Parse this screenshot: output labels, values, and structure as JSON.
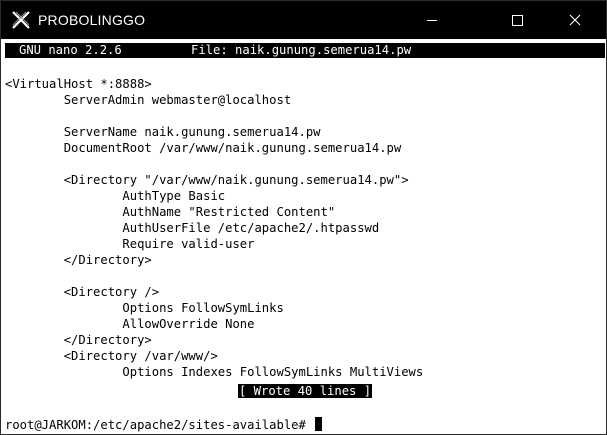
{
  "window": {
    "title": "PROBOLINGGO",
    "icon": "xterm-x-icon"
  },
  "nano": {
    "version": "GNU nano 2.2.6",
    "file_label": "File: naik.gunung.semerua14.pw",
    "lines": [
      "<VirtualHost *:8888>",
      "        ServerAdmin webmaster@localhost",
      "",
      "        ServerName naik.gunung.semerua14.pw",
      "        DocumentRoot /var/www/naik.gunung.semerua14.pw",
      "",
      "        <Directory \"/var/www/naik.gunung.semerua14.pw\">",
      "                AuthType Basic",
      "                AuthName \"Restricted Content\"",
      "                AuthUserFile /etc/apache2/.htpasswd",
      "                Require valid-user",
      "        </Directory>",
      "",
      "        <Directory />",
      "                Options FollowSymLinks",
      "                AllowOverride None",
      "        </Directory>",
      "        <Directory /var/www/>",
      "                Options Indexes FollowSymLinks MultiViews"
    ],
    "status_message": "[ Wrote 40 lines ]"
  },
  "shell": {
    "prompt": "root@JARKOM:/etc/apache2/sites-available# "
  }
}
